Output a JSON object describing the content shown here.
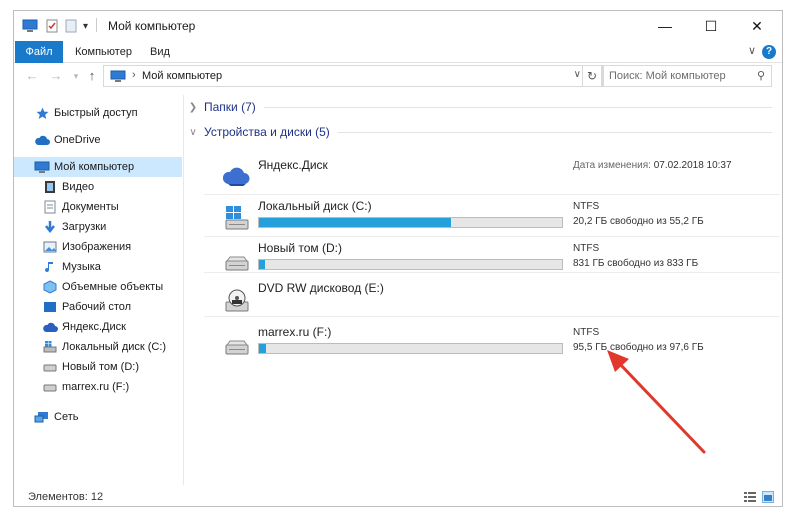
{
  "window": {
    "title": "Мой компьютер",
    "buttons": {
      "minimize": "—",
      "maximize": "☐",
      "close": "✕"
    }
  },
  "ribbon": {
    "tabs": [
      "Файл",
      "Компьютер",
      "Вид"
    ],
    "expand": "∨",
    "help": "?"
  },
  "address": {
    "path": "Мой компьютер",
    "search_placeholder": "Поиск: Мой компьютер"
  },
  "sidebar": {
    "items": [
      {
        "label": "Быстрый доступ",
        "icon": "star-icon"
      },
      {
        "label": "OneDrive",
        "icon": "cloud-icon"
      },
      {
        "label": "Мой компьютер",
        "icon": "computer-icon",
        "selected": true
      },
      {
        "label": "Видео",
        "icon": "video-icon"
      },
      {
        "label": "Документы",
        "icon": "document-icon"
      },
      {
        "label": "Загрузки",
        "icon": "download-icon"
      },
      {
        "label": "Изображения",
        "icon": "image-icon"
      },
      {
        "label": "Музыка",
        "icon": "music-icon"
      },
      {
        "label": "Объемные объекты",
        "icon": "3d-objects-icon"
      },
      {
        "label": "Рабочий стол",
        "icon": "desktop-icon"
      },
      {
        "label": "Яндекс.Диск",
        "icon": "yandex-disk-icon"
      },
      {
        "label": "Локальный диск (C:)",
        "icon": "windows-drive-icon"
      },
      {
        "label": "Новый том (D:)",
        "icon": "drive-icon"
      },
      {
        "label": "marrex.ru (F:)",
        "icon": "drive-icon"
      },
      {
        "label": "Сеть",
        "icon": "network-icon"
      }
    ]
  },
  "main": {
    "groups": [
      {
        "label": "Папки (7)",
        "expanded": false
      },
      {
        "label": "Устройства и диски (5)",
        "expanded": true
      }
    ],
    "drives": [
      {
        "name": "Яндекс.Диск",
        "modified_label": "Дата изменения:",
        "modified_value": "07.02.2018 10:37"
      },
      {
        "name": "Локальный диск (C:)",
        "fs": "NTFS",
        "free_text": "20,2 ГБ свободно из 55,2 ГБ",
        "used_fraction": 0.634
      },
      {
        "name": "Новый том (D:)",
        "fs": "NTFS",
        "free_text": "831 ГБ свободно из 833 ГБ",
        "used_fraction": 0.002
      },
      {
        "name": "DVD RW дисковод (E:)"
      },
      {
        "name": "marrex.ru (F:)",
        "fs": "NTFS",
        "free_text": "95,5 ГБ свободно из 97,6 ГБ",
        "used_fraction": 0.022
      }
    ]
  },
  "status": {
    "count": "Элементов: 12"
  },
  "colors": {
    "accent": "#1979ca",
    "selection": "#cce8ff",
    "bar_fill": "#26a0da",
    "arrow": "#e0392b"
  }
}
